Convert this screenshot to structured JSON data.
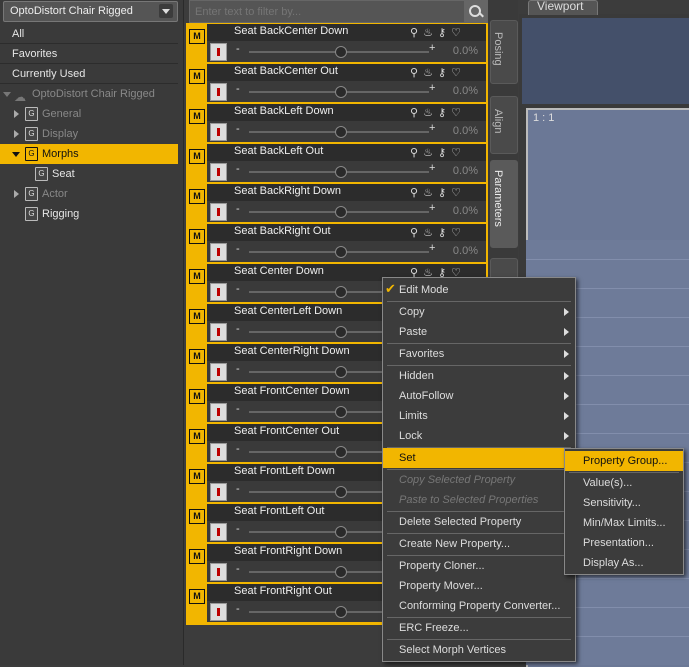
{
  "node_select": {
    "value": "OptoDistort Chair Rigged"
  },
  "tree": {
    "all": "All",
    "favorites": "Favorites",
    "currently_used": "Currently Used",
    "node": "OptoDistort Chair Rigged",
    "general": "General",
    "display": "Display",
    "morphs": "Morphs",
    "seat": "Seat",
    "actor": "Actor",
    "rigging": "Rigging"
  },
  "filter": {
    "placeholder": "Enter text to filter by..."
  },
  "properties": [
    {
      "name": "Seat BackCenter Down",
      "value": "0.0%"
    },
    {
      "name": "Seat BackCenter Out",
      "value": "0.0%"
    },
    {
      "name": "Seat BackLeft Down",
      "value": "0.0%"
    },
    {
      "name": "Seat BackLeft Out",
      "value": "0.0%"
    },
    {
      "name": "Seat BackRight Down",
      "value": "0.0%"
    },
    {
      "name": "Seat BackRight Out",
      "value": "0.0%"
    },
    {
      "name": "Seat Center Down",
      "value": ""
    },
    {
      "name": "Seat CenterLeft Down",
      "value": ""
    },
    {
      "name": "Seat CenterRight Down",
      "value": ""
    },
    {
      "name": "Seat FrontCenter Down",
      "value": ""
    },
    {
      "name": "Seat FrontCenter Out",
      "value": ""
    },
    {
      "name": "Seat FrontLeft Down",
      "value": ""
    },
    {
      "name": "Seat FrontLeft Out",
      "value": ""
    },
    {
      "name": "Seat FrontRight Down",
      "value": ""
    },
    {
      "name": "Seat FrontRight Out",
      "value": ""
    }
  ],
  "m_label": "M",
  "minus": "-",
  "plus": "+",
  "side_tabs": {
    "posing": "Posing",
    "align": "Align",
    "parameters": "Parameters"
  },
  "viewport": {
    "tab": "Viewport",
    "label": "1 : 1"
  },
  "context_menu": {
    "edit_mode": "Edit Mode",
    "copy": "Copy",
    "paste": "Paste",
    "favorites": "Favorites",
    "hidden": "Hidden",
    "autofollow": "AutoFollow",
    "limits": "Limits",
    "lock": "Lock",
    "set": "Set",
    "copy_selected": "Copy Selected Property",
    "paste_selected": "Paste to Selected Properties",
    "delete_selected": "Delete Selected Property",
    "create_new": "Create New Property...",
    "cloner": "Property Cloner...",
    "mover": "Property Mover...",
    "converter": "Conforming Property Converter...",
    "erc_freeze": "ERC Freeze...",
    "select_morph": "Select Morph Vertices"
  },
  "set_submenu": {
    "property_group": "Property Group...",
    "values": "Value(s)...",
    "sensitivity": "Sensitivity...",
    "min_max": "Min/Max Limits...",
    "presentation": "Presentation...",
    "display_as": "Display As..."
  }
}
